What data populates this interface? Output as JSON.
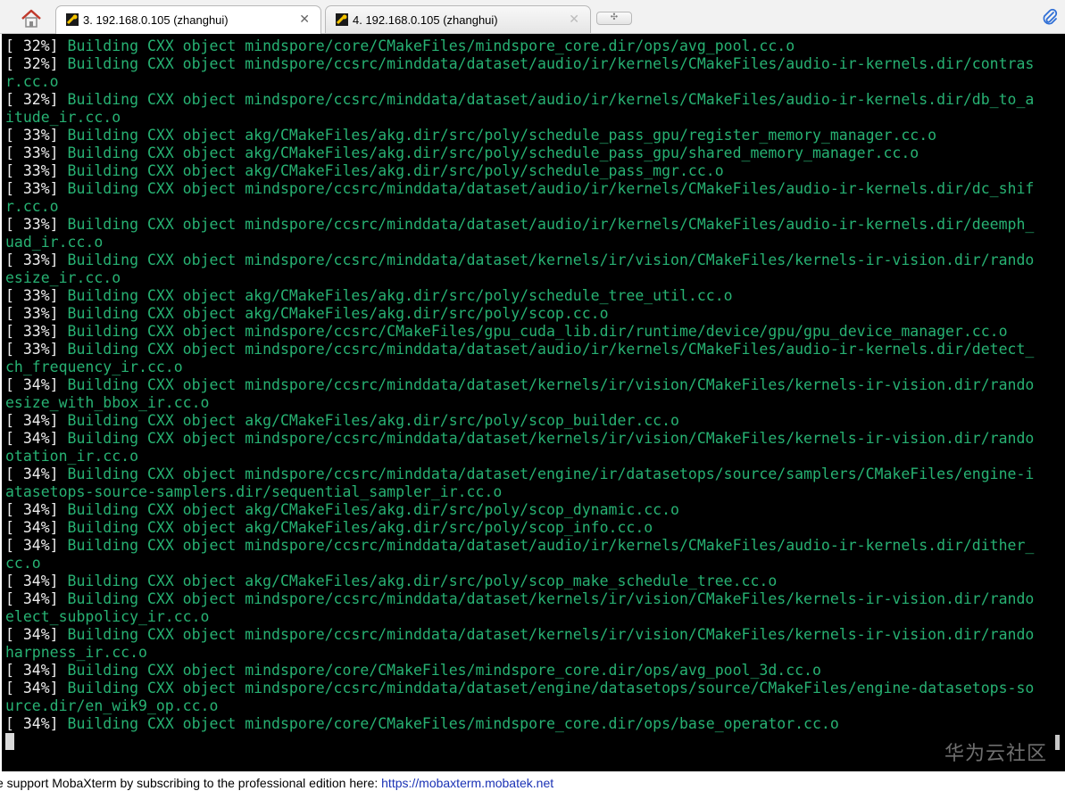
{
  "tabs": [
    {
      "label": "3. 192.168.0.105 (zhanghui)",
      "close": "✕",
      "active": true
    },
    {
      "label": "4. 192.168.0.105 (zhanghui)",
      "close": "✕",
      "active": false
    }
  ],
  "new_tab_glyph": "✣",
  "icons": {
    "home": "home-icon",
    "tab": "ssh-session-icon",
    "new_tab": "new-tab-icon",
    "attach": "paperclip-icon"
  },
  "colors": {
    "terminal_bg": "#000000",
    "percent_text": "#ededed",
    "build_text": "#27b273",
    "link": "#1a32b5"
  },
  "terminal": {
    "lines": [
      {
        "pct": "[ 32%] ",
        "text": "Building CXX object mindspore/core/CMakeFiles/mindspore_core.dir/ops/avg_pool.cc.o"
      },
      {
        "pct": "[ 32%] ",
        "text": "Building CXX object mindspore/ccsrc/minddata/dataset/audio/ir/kernels/CMakeFiles/audio-ir-kernels.dir/contras"
      },
      {
        "pct": "",
        "text": "r.cc.o"
      },
      {
        "pct": "[ 32%] ",
        "text": "Building CXX object mindspore/ccsrc/minddata/dataset/audio/ir/kernels/CMakeFiles/audio-ir-kernels.dir/db_to_a"
      },
      {
        "pct": "",
        "text": "itude_ir.cc.o"
      },
      {
        "pct": "[ 33%] ",
        "text": "Building CXX object akg/CMakeFiles/akg.dir/src/poly/schedule_pass_gpu/register_memory_manager.cc.o"
      },
      {
        "pct": "[ 33%] ",
        "text": "Building CXX object akg/CMakeFiles/akg.dir/src/poly/schedule_pass_gpu/shared_memory_manager.cc.o"
      },
      {
        "pct": "[ 33%] ",
        "text": "Building CXX object akg/CMakeFiles/akg.dir/src/poly/schedule_pass_mgr.cc.o"
      },
      {
        "pct": "[ 33%] ",
        "text": "Building CXX object mindspore/ccsrc/minddata/dataset/audio/ir/kernels/CMakeFiles/audio-ir-kernels.dir/dc_shif"
      },
      {
        "pct": "",
        "text": "r.cc.o"
      },
      {
        "pct": "[ 33%] ",
        "text": "Building CXX object mindspore/ccsrc/minddata/dataset/audio/ir/kernels/CMakeFiles/audio-ir-kernels.dir/deemph_"
      },
      {
        "pct": "",
        "text": "uad_ir.cc.o"
      },
      {
        "pct": "[ 33%] ",
        "text": "Building CXX object mindspore/ccsrc/minddata/dataset/kernels/ir/vision/CMakeFiles/kernels-ir-vision.dir/rando"
      },
      {
        "pct": "",
        "text": "esize_ir.cc.o"
      },
      {
        "pct": "[ 33%] ",
        "text": "Building CXX object akg/CMakeFiles/akg.dir/src/poly/schedule_tree_util.cc.o"
      },
      {
        "pct": "[ 33%] ",
        "text": "Building CXX object akg/CMakeFiles/akg.dir/src/poly/scop.cc.o"
      },
      {
        "pct": "[ 33%] ",
        "text": "Building CXX object mindspore/ccsrc/CMakeFiles/gpu_cuda_lib.dir/runtime/device/gpu/gpu_device_manager.cc.o"
      },
      {
        "pct": "[ 33%] ",
        "text": "Building CXX object mindspore/ccsrc/minddata/dataset/audio/ir/kernels/CMakeFiles/audio-ir-kernels.dir/detect_"
      },
      {
        "pct": "",
        "text": "ch_frequency_ir.cc.o"
      },
      {
        "pct": "[ 34%] ",
        "text": "Building CXX object mindspore/ccsrc/minddata/dataset/kernels/ir/vision/CMakeFiles/kernels-ir-vision.dir/rando"
      },
      {
        "pct": "",
        "text": "esize_with_bbox_ir.cc.o"
      },
      {
        "pct": "[ 34%] ",
        "text": "Building CXX object akg/CMakeFiles/akg.dir/src/poly/scop_builder.cc.o"
      },
      {
        "pct": "[ 34%] ",
        "text": "Building CXX object mindspore/ccsrc/minddata/dataset/kernels/ir/vision/CMakeFiles/kernels-ir-vision.dir/rando"
      },
      {
        "pct": "",
        "text": "otation_ir.cc.o"
      },
      {
        "pct": "[ 34%] ",
        "text": "Building CXX object mindspore/ccsrc/minddata/dataset/engine/ir/datasetops/source/samplers/CMakeFiles/engine-i"
      },
      {
        "pct": "",
        "text": "atasetops-source-samplers.dir/sequential_sampler_ir.cc.o"
      },
      {
        "pct": "[ 34%] ",
        "text": "Building CXX object akg/CMakeFiles/akg.dir/src/poly/scop_dynamic.cc.o"
      },
      {
        "pct": "[ 34%] ",
        "text": "Building CXX object akg/CMakeFiles/akg.dir/src/poly/scop_info.cc.o"
      },
      {
        "pct": "[ 34%] ",
        "text": "Building CXX object mindspore/ccsrc/minddata/dataset/audio/ir/kernels/CMakeFiles/audio-ir-kernels.dir/dither_"
      },
      {
        "pct": "",
        "text": "cc.o"
      },
      {
        "pct": "[ 34%] ",
        "text": "Building CXX object akg/CMakeFiles/akg.dir/src/poly/scop_make_schedule_tree.cc.o"
      },
      {
        "pct": "[ 34%] ",
        "text": "Building CXX object mindspore/ccsrc/minddata/dataset/kernels/ir/vision/CMakeFiles/kernels-ir-vision.dir/rando"
      },
      {
        "pct": "",
        "text": "elect_subpolicy_ir.cc.o"
      },
      {
        "pct": "[ 34%] ",
        "text": "Building CXX object mindspore/ccsrc/minddata/dataset/kernels/ir/vision/CMakeFiles/kernels-ir-vision.dir/rando"
      },
      {
        "pct": "",
        "text": "harpness_ir.cc.o"
      },
      {
        "pct": "[ 34%] ",
        "text": "Building CXX object mindspore/core/CMakeFiles/mindspore_core.dir/ops/avg_pool_3d.cc.o"
      },
      {
        "pct": "[ 34%] ",
        "text": "Building CXX object mindspore/ccsrc/minddata/dataset/engine/datasetops/source/CMakeFiles/engine-datasetops-so"
      },
      {
        "pct": "",
        "text": "urce.dir/en_wik9_op.cc.o"
      },
      {
        "pct": "[ 34%] ",
        "text": "Building CXX object mindspore/core/CMakeFiles/mindspore_core.dir/ops/base_operator.cc.o"
      }
    ],
    "watermark": "华为云社区"
  },
  "status_bar": {
    "text": "e support MobaXterm by subscribing to the professional edition here:  ",
    "link": "https://mobaxterm.mobatek.net"
  }
}
